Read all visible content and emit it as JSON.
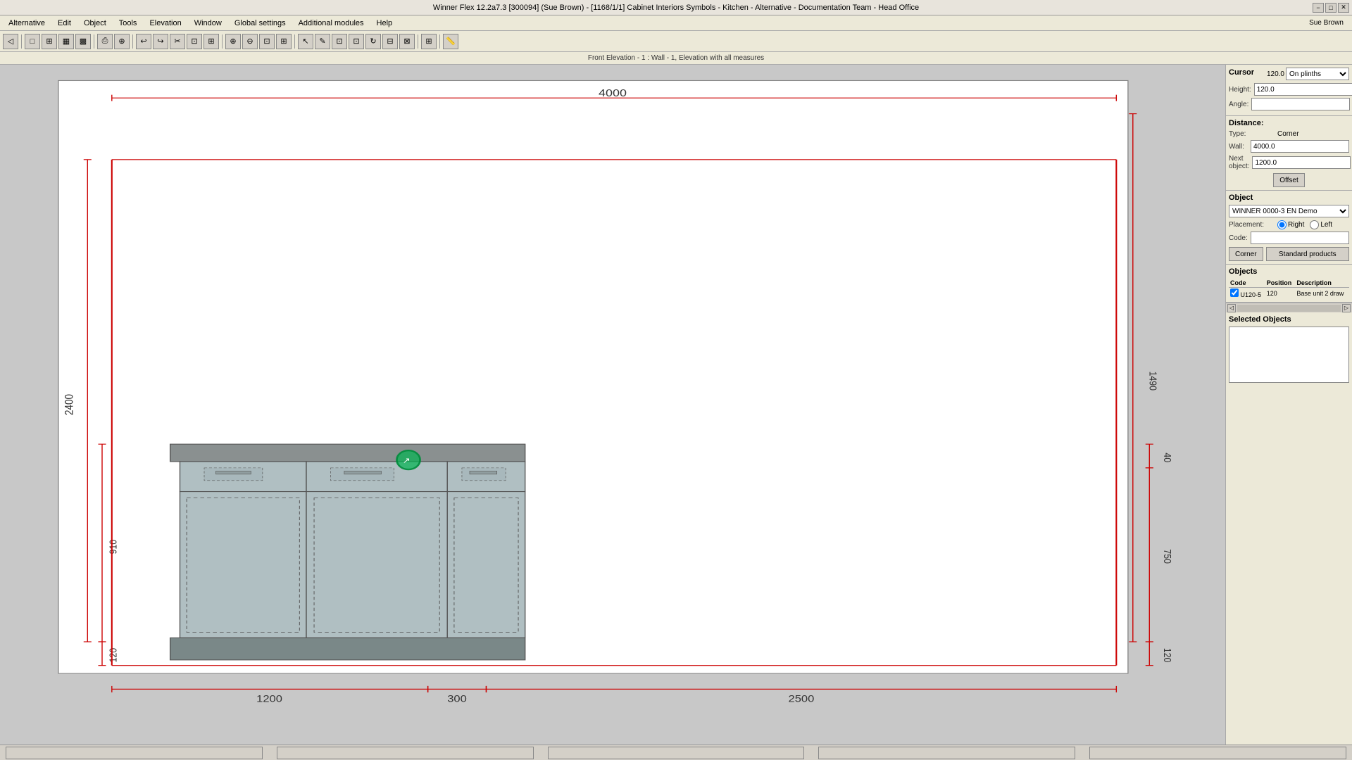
{
  "titlebar": {
    "title": "Winner Flex 12.2a7.3  [300094] (Sue Brown)  -  [1168/1/1] Cabinet Interiors Symbols - Kitchen - Alternative - Documentation Team - Head Office",
    "minimize": "−",
    "maximize": "□",
    "close": "✕"
  },
  "menubar": {
    "items": [
      "Alternative",
      "Edit",
      "Object",
      "Tools",
      "Elevation",
      "Window",
      "Global settings",
      "Additional modules",
      "Help"
    ]
  },
  "toolbar": {
    "groups": [
      [
        "←",
        "→"
      ],
      [
        "□",
        "⊞",
        "⊟",
        "⊡"
      ],
      [
        "🖨",
        "⊕"
      ],
      [
        "↩",
        "↪",
        "✂",
        "⊡",
        "⊡"
      ],
      [
        "⊕",
        "⊕",
        "⊕",
        "⊕",
        "⊡"
      ],
      [
        "▶",
        "✎",
        "⊡",
        "⊡",
        "⊡",
        "⊡",
        "⊡"
      ],
      [
        "⊞"
      ],
      [
        "⊡"
      ]
    ]
  },
  "status_top": {
    "text": "Front Elevation - 1 : Wall - 1, Elevation with all measures"
  },
  "right_panel": {
    "cursor_section": {
      "title": "Cursor",
      "value": "120.0",
      "dropdown": "On plinths",
      "height_label": "Height:",
      "height_value": "120.0",
      "angle_label": "Angle:"
    },
    "distance_section": {
      "title": "Distance:",
      "type_label": "Type:",
      "corner_label": "Corner",
      "wall_label": "Wall:",
      "wall_value": "4000.0",
      "next_label": "Next object:",
      "next_value": "1200.0",
      "offset_btn": "Offset"
    },
    "object_section": {
      "title": "Object",
      "dropdown": "WINNER 0000-3 EN Demo",
      "placement_label": "Placement:",
      "right_label": "Right",
      "left_label": "Left",
      "code_label": "Code:",
      "code_value": "",
      "corner_btn": "Corner",
      "standard_btn": "Standard products"
    },
    "objects_section": {
      "title": "Objects",
      "columns": [
        "Code",
        "Position",
        "Description"
      ],
      "rows": [
        {
          "checkbox": true,
          "code": "U120-5",
          "position": "120",
          "description": "Base unit 2 draw"
        }
      ]
    },
    "selected_objects": {
      "title": "Selected Objects"
    }
  },
  "canvas": {
    "elevation_label": "4000",
    "dim_top": "2400",
    "dim_right_total": "1490",
    "dim_right_top": "40",
    "dim_right_mid": "750",
    "dim_right_bot": "120",
    "dim_left_top": "2400",
    "dim_left_mid": "910",
    "dim_left_bot": "120",
    "dim_bottom_left": "1200",
    "dim_bottom_mid": "300",
    "dim_bottom_right": "2500"
  },
  "statusbar": {
    "segments": [
      "",
      "",
      "",
      "",
      ""
    ]
  }
}
